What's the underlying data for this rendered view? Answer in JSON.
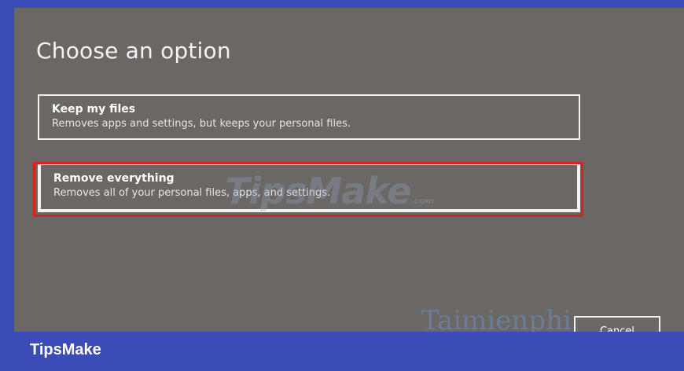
{
  "dialog": {
    "title": "Choose an option",
    "options": [
      {
        "title": "Keep my files",
        "description": "Removes apps and settings, but keeps your personal files."
      },
      {
        "title": "Remove everything",
        "description": "Removes all of your personal files, apps, and settings."
      }
    ],
    "cancel_label": "Cancel"
  },
  "watermarks": {
    "center": "TipsMake",
    "center_suffix": ".com",
    "bottom": "Taimienphi"
  },
  "brand": {
    "name": "TipsMake"
  },
  "colors": {
    "panel_background": "#6b6765",
    "frame_background": "#3b4bb8",
    "highlight": "#d8231a"
  }
}
